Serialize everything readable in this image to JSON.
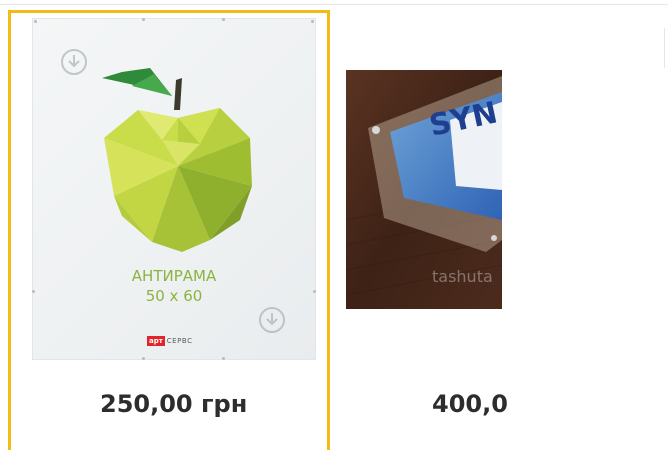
{
  "products": [
    {
      "image_alt": "antirama 50x60 apple poster",
      "image_title_line1": "АНТИРАМА",
      "image_title_line2": "50 х 60",
      "logo_box": "арт",
      "logo_text": "СЕРВС",
      "price": "250,00 грн",
      "selected": true
    },
    {
      "image_alt": "acrylic sign plate",
      "image_watermark": "tashuta",
      "price": "400,0",
      "selected": false
    }
  ],
  "colors": {
    "selection_border": "#f2bc16",
    "price_text": "#2d2d2d",
    "title_green": "#8bb33f"
  }
}
